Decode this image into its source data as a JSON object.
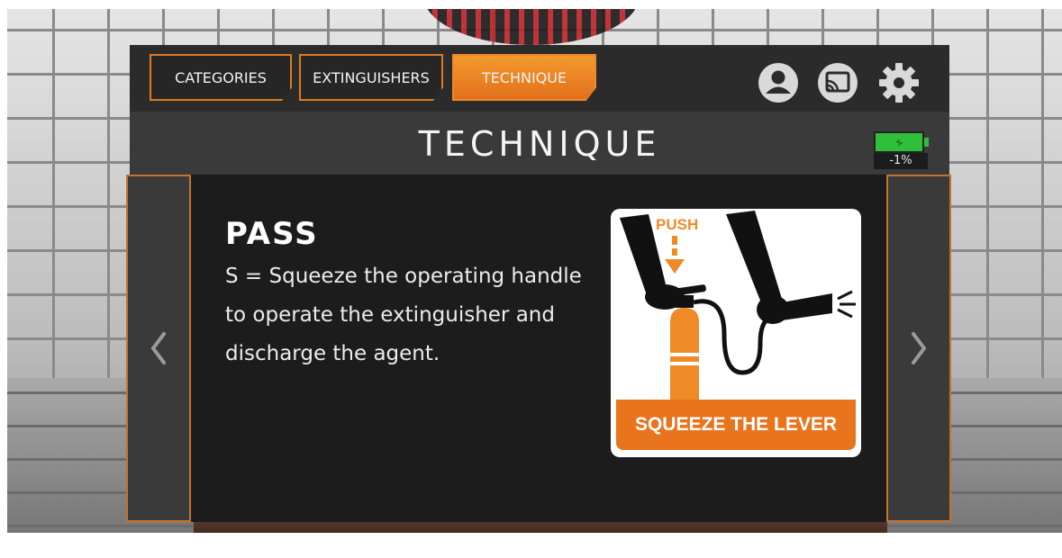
{
  "nav": {
    "tabs": [
      {
        "label": "CATEGORIES",
        "active": false
      },
      {
        "label": "EXTINGUISHERS",
        "active": false
      },
      {
        "label": "TECHNIQUE",
        "active": true
      }
    ],
    "icons": [
      "user-profile-icon",
      "cast-icon",
      "settings-gear-icon"
    ]
  },
  "header": {
    "title": "TECHNIQUE",
    "battery_percent": "-1%"
  },
  "content": {
    "heading": "PASS",
    "body": "S = Squeeze the operating handle to operate the extinguisher and discharge the agent.",
    "illustration": {
      "push_label": "PUSH",
      "caption": "SQUEEZE THE LEVER"
    }
  },
  "colors": {
    "accent_orange": "#e8741d",
    "panel_dark": "#1f1f1f",
    "battery_green": "#2fbf3a"
  }
}
